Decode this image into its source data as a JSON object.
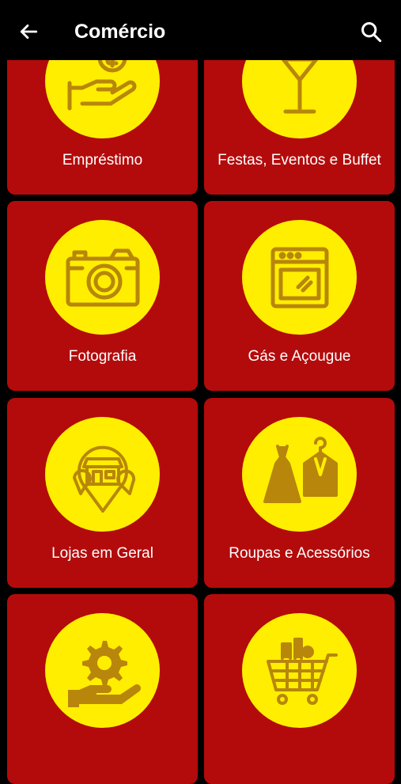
{
  "header": {
    "title": "Comércio",
    "back_icon": "arrow-left-icon",
    "search_icon": "search-icon"
  },
  "colors": {
    "background": "#000000",
    "card": "#b30b0b",
    "circle": "#ffee00",
    "icon": "#b8860b",
    "text": "#ffffff"
  },
  "categories": [
    {
      "label": "Empréstimo",
      "icon": "money-hand-icon"
    },
    {
      "label": "Festas, Eventos e Buffet",
      "icon": "cocktail-glass-icon"
    },
    {
      "label": "Fotografia",
      "icon": "camera-icon"
    },
    {
      "label": "Gás e Açougue",
      "icon": "oven-icon"
    },
    {
      "label": "Lojas em Geral",
      "icon": "store-map-icon"
    },
    {
      "label": "Roupas e Acessórios",
      "icon": "dress-suit-icon"
    },
    {
      "label": "",
      "icon": "gear-hand-icon"
    },
    {
      "label": "",
      "icon": "shopping-cart-icon"
    }
  ]
}
